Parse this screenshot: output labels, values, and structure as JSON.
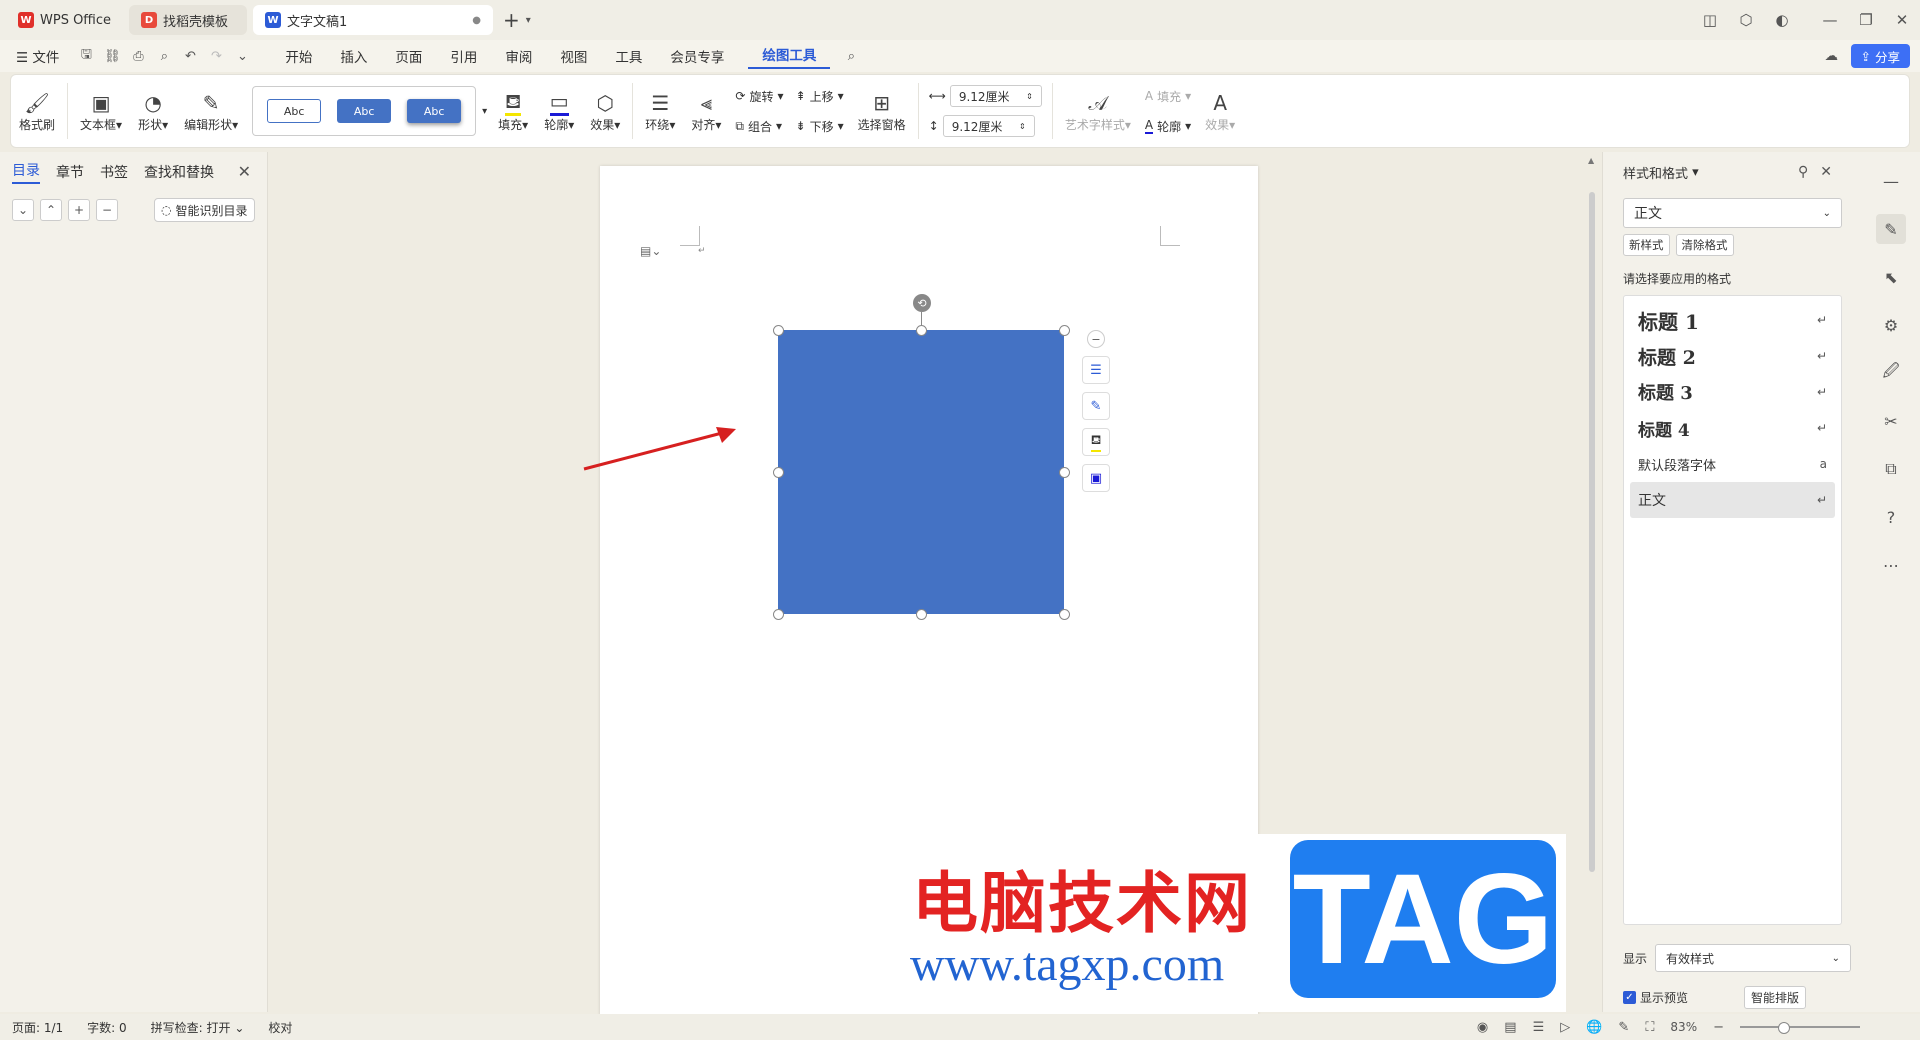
{
  "titlebar": {
    "tabs": [
      {
        "label": "WPS Office",
        "icon": "wps-logo-icon"
      },
      {
        "label": "找稻壳模板",
        "icon": "docer-icon"
      },
      {
        "label": "文字文稿1",
        "icon": "writer-doc-icon"
      }
    ],
    "new_tab": "+"
  },
  "menubar": {
    "file": "文件",
    "items": [
      "开始",
      "插入",
      "页面",
      "引用",
      "审阅",
      "视图",
      "工具",
      "会员专享",
      "绘图工具"
    ],
    "active": "绘图工具",
    "share": "分享"
  },
  "ribbon": {
    "format_painter": "格式刷",
    "textbox": "文本框",
    "shape": "形状",
    "edit_shape": "编辑形状",
    "gallery": [
      "Abc",
      "Abc",
      "Abc"
    ],
    "fill": "填充",
    "outline": "轮廓",
    "effect": "效果",
    "wrap": "环绕",
    "align": "对齐",
    "rotate": "旋转",
    "group": "组合",
    "bring_forward": "上移",
    "send_backward": "下移",
    "selection_pane": "选择窗格",
    "width": "9.12厘米",
    "height": "9.12厘米",
    "art_style": "艺术字样式",
    "text_fill": "填充",
    "text_outline": "轮廓",
    "text_effect": "效果"
  },
  "leftpane": {
    "tabs": [
      "目录",
      "章节",
      "书签",
      "查找和替换"
    ],
    "active": "目录",
    "smart_toc": "智能识别目录"
  },
  "document": {
    "shape_color": "#4472c4"
  },
  "watermark": {
    "text": "电脑技术网",
    "url": "www.tagxp.com",
    "tag": "TAG"
  },
  "rightpane": {
    "title": "样式和格式",
    "current_style": "正文",
    "new_style": "新样式",
    "clear_format": "清除格式",
    "apply_label": "请选择要应用的格式",
    "styles": [
      "标题 1",
      "标题 2",
      "标题 3",
      "标题 4",
      "默认段落字体",
      "正文"
    ],
    "show_label": "显示",
    "show_value": "有效样式",
    "preview_label": "显示预览",
    "smart_layout": "智能排版"
  },
  "statusbar": {
    "page": "页面: 1/1",
    "words": "字数: 0",
    "spell": "拼写检查: 打开",
    "proof": "校对",
    "zoom": "83%"
  }
}
